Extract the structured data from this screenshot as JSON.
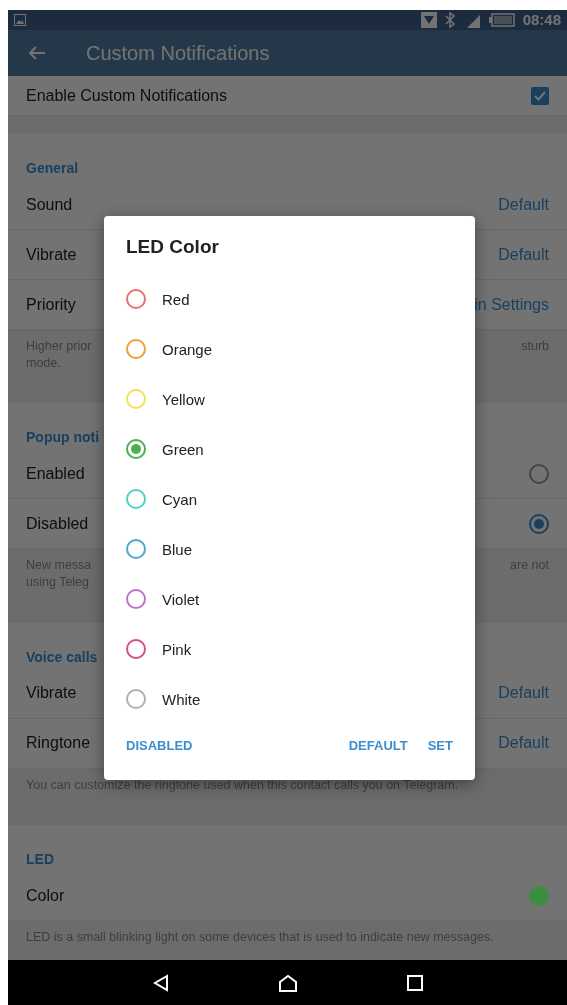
{
  "status_bar": {
    "time": "08:48"
  },
  "app_bar": {
    "title": "Custom Notifications"
  },
  "enable_row": {
    "label": "Enable Custom Notifications",
    "checked": true
  },
  "sections": [
    {
      "header": "General",
      "rows": [
        {
          "kind": "value",
          "label": "Sound",
          "value": "Default"
        },
        {
          "kind": "value",
          "label": "Vibrate",
          "value": "Default"
        },
        {
          "kind": "value",
          "label": "Priority",
          "value": "in Settings"
        }
      ],
      "hint_left": "Higher prior\nmode.",
      "hint_right": "sturb"
    },
    {
      "header": "Popup noti",
      "rows": [
        {
          "kind": "radio",
          "label": "Enabled",
          "selected": false
        },
        {
          "kind": "radio",
          "label": "Disabled",
          "selected": true
        }
      ],
      "hint_left": "New messa\nusing Teleg",
      "hint_right": "are not"
    },
    {
      "header": "Voice calls",
      "rows": [
        {
          "kind": "value",
          "label": "Vibrate",
          "value": "Default"
        },
        {
          "kind": "value",
          "label": "Ringtone",
          "value": "Default"
        }
      ],
      "hint_left": "You can customize the ringtone used when this contact calls you on Telegram."
    },
    {
      "header": "LED",
      "rows": [
        {
          "kind": "color",
          "label": "Color",
          "color": "#3e8e41"
        }
      ],
      "hint_left": "LED is a small blinking light on some devices that is used to indicate new messages."
    }
  ],
  "dialog": {
    "title": "LED Color",
    "options": [
      {
        "label": "Red",
        "color": "#e57373",
        "selected": false
      },
      {
        "label": "Orange",
        "color": "#f0a030",
        "selected": false
      },
      {
        "label": "Yellow",
        "color": "#f5e050",
        "selected": false
      },
      {
        "label": "Green",
        "color": "#4caf50",
        "selected": true
      },
      {
        "label": "Cyan",
        "color": "#4dd0c8",
        "selected": false
      },
      {
        "label": "Blue",
        "color": "#4aa8c8",
        "selected": false
      },
      {
        "label": "Violet",
        "color": "#c070d0",
        "selected": false
      },
      {
        "label": "Pink",
        "color": "#d0508a",
        "selected": false
      },
      {
        "label": "White",
        "color": "#b0b0b0",
        "selected": false
      }
    ],
    "buttons": [
      "DISABLED",
      "DEFAULT",
      "SET"
    ]
  }
}
